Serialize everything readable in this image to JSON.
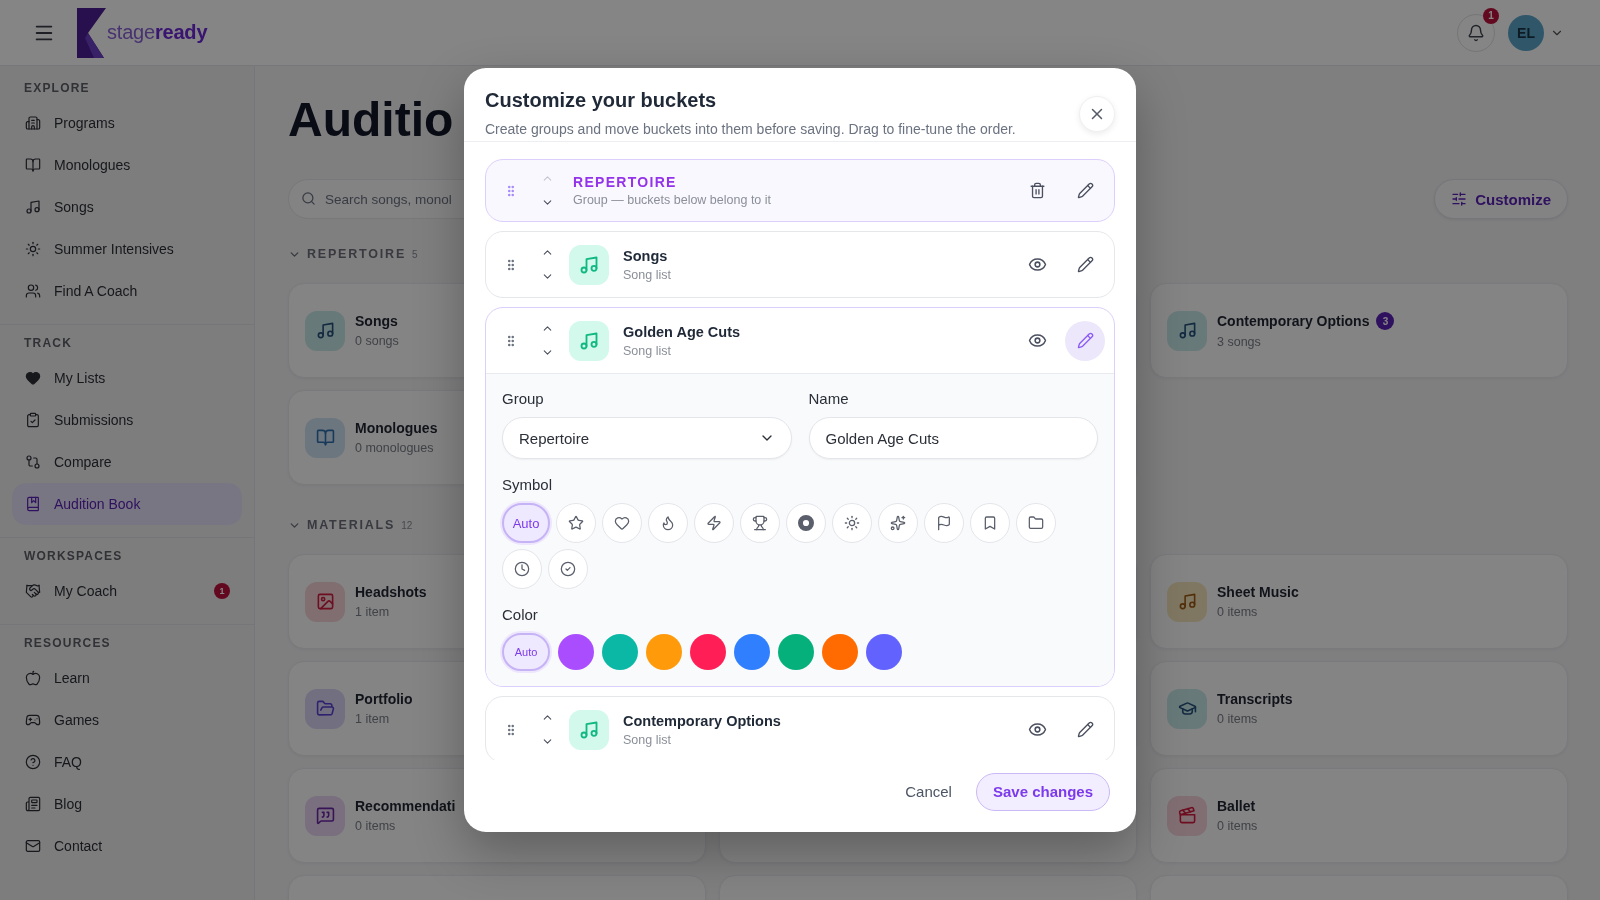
{
  "header": {
    "logo_text": "stage**ready**",
    "notifications": {
      "count": "1"
    },
    "user": {
      "initials": "EL"
    }
  },
  "sidebar": {
    "sections": [
      {
        "title": "EXPLORE",
        "items": [
          {
            "label": "Programs",
            "selected": false
          },
          {
            "label": "Monologues",
            "selected": false
          },
          {
            "label": "Songs",
            "selected": false
          },
          {
            "label": "Summer Intensives",
            "selected": false
          },
          {
            "label": "Find A Coach",
            "selected": false
          }
        ]
      },
      {
        "title": "TRACK",
        "items": [
          {
            "label": "My Lists",
            "selected": false
          },
          {
            "label": "Submissions",
            "selected": false
          },
          {
            "label": "Compare",
            "selected": false
          },
          {
            "label": "Audition Book",
            "selected": true
          }
        ]
      },
      {
        "title": "WORKSPACES",
        "items": [
          {
            "label": "My Coach",
            "selected": false,
            "badge": "1"
          }
        ]
      },
      {
        "title": "RESOURCES",
        "items": [
          {
            "label": "Learn",
            "selected": false
          },
          {
            "label": "Games",
            "selected": false
          },
          {
            "label": "FAQ",
            "selected": false
          },
          {
            "label": "Blog",
            "selected": false
          },
          {
            "label": "Contact",
            "selected": false
          }
        ]
      }
    ]
  },
  "main": {
    "title": "Auditio",
    "search": {
      "placeholder": "Search songs, monol"
    },
    "customize_button": "Customize",
    "sections": [
      {
        "title": "REPERTOIRE",
        "count": "5",
        "expanded": true,
        "rows": [
          {
            "column_1": {
              "kind": "music",
              "name": "Songs",
              "meta": "0 songs"
            },
            "column_3": {
              "kind": "music",
              "name": "Contemporary Options",
              "meta": "3 songs",
              "badge": "3"
            }
          },
          {
            "column_1": {
              "kind": "book",
              "name": "Monologues",
              "meta": "0 monologues"
            }
          }
        ]
      },
      {
        "title": "MATERIALS",
        "count": "12",
        "expanded": true,
        "rows": [
          {
            "column_1": {
              "kind": "image",
              "name": "Headshots",
              "meta": "1 item"
            },
            "column_3": {
              "kind": "sheet",
              "name": "Sheet Music",
              "meta": "0 items"
            }
          },
          {
            "column_1": {
              "kind": "folder",
              "name": "Portfolio",
              "meta": "1 item"
            },
            "column_3": {
              "kind": "cap",
              "name": "Transcripts",
              "meta": "0 items"
            }
          },
          {
            "column_1": {
              "kind": "quote",
              "name": "Recommendati",
              "meta": "0 items"
            },
            "column_3": {
              "kind": "film",
              "name": "Ballet",
              "meta": "0 items"
            }
          }
        ]
      }
    ]
  },
  "modal": {
    "title": "Customize your buckets",
    "subtitle": "Create groups and move buckets into them before saving. Drag to fine-tune the order.",
    "rows": [
      {
        "kind": "group",
        "title": "REPERTOIRE",
        "subtitle": "Group — buckets below belong to it",
        "up_disabled": true,
        "expanded": false
      },
      {
        "kind": "bucket",
        "title": "Songs",
        "subtitle": "Song list",
        "up_disabled": false,
        "expanded": false
      },
      {
        "kind": "bucket",
        "title": "Golden Age Cuts",
        "subtitle": "Song list",
        "up_disabled": false,
        "expanded": true,
        "editor": {
          "group": {
            "label": "Group",
            "value": "Repertoire"
          },
          "name": {
            "label": "Name",
            "value": "Golden Age Cuts"
          },
          "symbol": {
            "label": "Symbol",
            "options": [
              {
                "kind": "auto",
                "label": "Auto",
                "selected": true
              },
              {
                "kind": "star",
                "selected": false
              },
              {
                "kind": "heart",
                "selected": false
              },
              {
                "kind": "flame",
                "selected": false
              },
              {
                "kind": "bolt",
                "selected": false
              },
              {
                "kind": "trophy",
                "selected": false
              },
              {
                "kind": "disc",
                "selected": false
              },
              {
                "kind": "sun",
                "selected": false
              },
              {
                "kind": "sparkles",
                "selected": false
              },
              {
                "kind": "flag",
                "selected": false
              },
              {
                "kind": "bookmark",
                "selected": false
              },
              {
                "kind": "folder",
                "selected": false
              },
              {
                "kind": "clock",
                "selected": false
              },
              {
                "kind": "check",
                "selected": false
              }
            ]
          },
          "color": {
            "label": "Color",
            "options": [
              {
                "kind": "auto",
                "label": "Auto",
                "selected": true
              },
              {
                "kind": "swatch",
                "color": "#a94dff",
                "selected": false
              },
              {
                "kind": "swatch",
                "color": "#0bb8a5",
                "selected": false
              },
              {
                "kind": "swatch",
                "color": "#ff9a0b",
                "selected": false
              },
              {
                "kind": "swatch",
                "color": "#ff1f56",
                "selected": false
              },
              {
                "kind": "swatch",
                "color": "#2f7ffe",
                "selected": false
              },
              {
                "kind": "swatch",
                "color": "#06b07b",
                "selected": false
              },
              {
                "kind": "swatch",
                "color": "#ff6b00",
                "selected": false
              },
              {
                "kind": "swatch",
                "color": "#6262ff",
                "selected": false
              }
            ]
          }
        }
      },
      {
        "kind": "bucket",
        "title": "Contemporary Options",
        "subtitle": "Song list",
        "up_disabled": false,
        "expanded": false
      }
    ],
    "footer": {
      "cancel": "Cancel",
      "save": "Save changes"
    }
  }
}
